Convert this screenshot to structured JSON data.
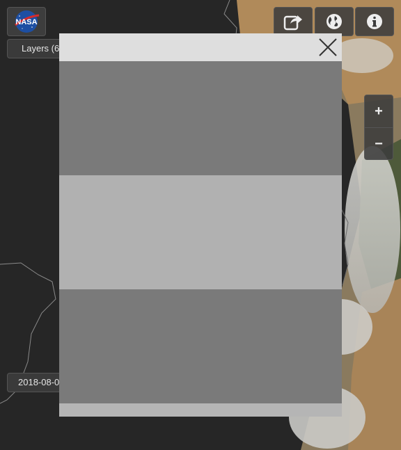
{
  "app": {
    "logo_text": "NASA",
    "colors": {
      "ui_background": "#262626",
      "button_bg": "#3c3c3c",
      "modal_header": "#dedede",
      "modal_band_dark": "#7a7a7a",
      "modal_band_light": "#b1b1b1"
    }
  },
  "sidebar": {
    "layers_label": "Layers (6",
    "date_label": "2018-08-0"
  },
  "toolbar": {
    "buttons": [
      {
        "name": "share",
        "icon": "share-icon"
      },
      {
        "name": "projection",
        "icon": "globe-icon"
      },
      {
        "name": "info",
        "icon": "info-icon"
      }
    ]
  },
  "zoom": {
    "in_label": "+",
    "out_label": "−"
  },
  "modal": {
    "close_icon": "close-icon"
  }
}
